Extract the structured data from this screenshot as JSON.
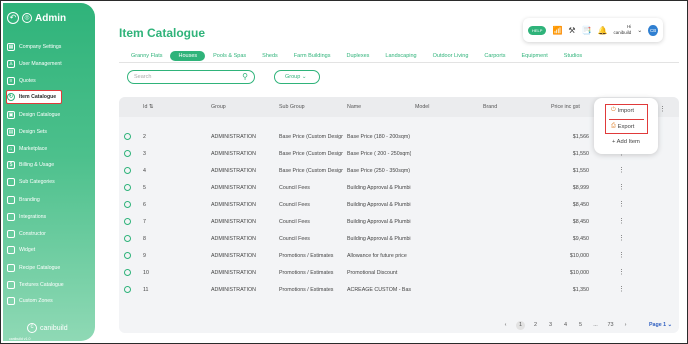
{
  "sidebar": {
    "title": "Admin",
    "items": [
      {
        "label": "Company Settings",
        "icon": "building-icon"
      },
      {
        "label": "User Management",
        "icon": "users-icon"
      },
      {
        "label": "Quotes",
        "icon": "document-icon"
      },
      {
        "label": "Item Catalogue",
        "icon": "catalogue-icon",
        "active": true
      },
      {
        "label": "Design Catalogue",
        "icon": "design-icon"
      },
      {
        "label": "Design Sets",
        "icon": "sets-icon"
      },
      {
        "label": "Marketplace",
        "icon": "marketplace-icon"
      },
      {
        "label": "Billing & Usage",
        "icon": "billing-icon"
      },
      {
        "label": "Sub Categories",
        "icon": "folder-icon"
      },
      {
        "label": "Branding",
        "icon": "folder-icon"
      },
      {
        "label": "Integrations",
        "icon": "folder-icon"
      },
      {
        "label": "Constructor",
        "icon": "folder-icon"
      },
      {
        "label": "Widget",
        "icon": "folder-icon"
      },
      {
        "label": "Recipe Catalogue",
        "icon": "folder-icon"
      },
      {
        "label": "Textures Catalogue",
        "icon": "folder-icon"
      },
      {
        "label": "Custom Zones",
        "icon": "folder-icon"
      }
    ],
    "logo_text": "canibuild",
    "version": "canibuild v1.0"
  },
  "header": {
    "title": "Item Catalogue",
    "help_pill": "HELP",
    "user_greeting": "Hi",
    "user_name": "canibuild",
    "avatar_initials": "CB"
  },
  "tabs": [
    "Granny Flats",
    "Houses",
    "Pools & Spas",
    "Sheds",
    "Farm Buildings",
    "Duplexes",
    "Landscaping",
    "Outdoor Living",
    "Carports",
    "Equipment",
    "Studios"
  ],
  "active_tab": "Houses",
  "search": {
    "placeholder": "Search"
  },
  "group_button": "Group",
  "table": {
    "columns": [
      "Id",
      "Group",
      "Sub Group",
      "Name",
      "Model",
      "Brand",
      "Price inc gst"
    ],
    "rows": [
      [
        "2",
        "ADMINISTRATION",
        "Base Price (Custom Design)",
        "Base Price (180 - 200sqm)",
        "",
        "",
        "$1,566"
      ],
      [
        "3",
        "ADMINISTRATION",
        "Base Price (Custom Design)",
        "Base Price ( 200 - 250sqm)",
        "",
        "",
        "$1,550"
      ],
      [
        "4",
        "ADMINISTRATION",
        "Base Price (Custom Design)",
        "Base Price (250 - 350sqm)",
        "",
        "",
        "$1,550"
      ],
      [
        "5",
        "ADMINISTRATION",
        "Council Fees",
        "Building Approval & Plumbing",
        "",
        "",
        "$8,999"
      ],
      [
        "6",
        "ADMINISTRATION",
        "Council Fees",
        "Building Approval & Plumbing",
        "",
        "",
        "$8,450"
      ],
      [
        "7",
        "ADMINISTRATION",
        "Council Fees",
        "Building Approval & Plumbing",
        "",
        "",
        "$8,450"
      ],
      [
        "8",
        "ADMINISTRATION",
        "Council Fees",
        "Building Approval & Plumbing",
        "",
        "",
        "$9,450"
      ],
      [
        "9",
        "ADMINISTRATION",
        "Promotions / Estimates",
        "Allowance for future price",
        "",
        "",
        "$10,000"
      ],
      [
        "10",
        "ADMINISTRATION",
        "Promotions / Estimates",
        "Promotional Discount",
        "",
        "",
        "$10,000"
      ],
      [
        "11",
        "ADMINISTRATION",
        "Promotions / Estimates",
        "ACREAGE CUSTOM - Base I",
        "",
        "",
        "$1,350"
      ]
    ]
  },
  "menu": {
    "import": "Import",
    "export": "Export",
    "add_item": "+ Add Item"
  },
  "pagination": {
    "pages": [
      "1",
      "2",
      "3",
      "4",
      "5",
      "...",
      "73"
    ],
    "current": "1",
    "page_label": "Page 1"
  },
  "colors": {
    "accent": "#2fb37a",
    "highlight": "#e03a3a"
  }
}
